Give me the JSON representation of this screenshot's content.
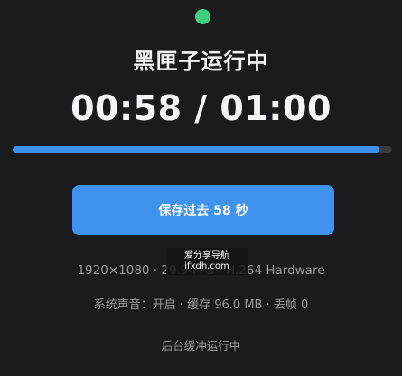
{
  "colors": {
    "status_dot": "#3ecf7d",
    "accent": "#3f92ee",
    "progress_track": "#3a3a3e"
  },
  "status_icon": "recording-dot-icon",
  "title": "黑匣子运行中",
  "timer": {
    "elapsed": "00:58",
    "separator": " / ",
    "total": "01:00"
  },
  "progress": {
    "fraction": 0.967
  },
  "save_button": {
    "label": "保存过去 58 秒"
  },
  "spec_line": "1920×1080 · 29.9 FPS · H.264 Hardware",
  "stats_line": "系统声音：开启 · 缓存 96.0 MB · 丢帧 0",
  "background_status": "后台缓冲运行中",
  "watermark": {
    "line1": "爱分享导航",
    "line2": "ifxdh.com"
  }
}
